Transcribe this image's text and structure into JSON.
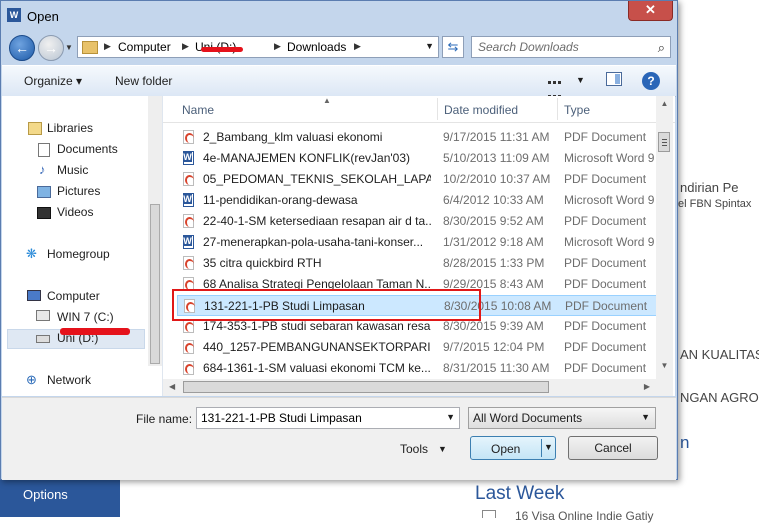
{
  "window": {
    "title": "Open",
    "close_label": "✕"
  },
  "background": {
    "options_label": "Options",
    "snippets": [
      "ndirian Pe",
      "el FBN Spintax",
      "AN KUALITAS",
      "NGAN AGRO",
      "n"
    ],
    "last_week": "Last Week",
    "partial_line": "16 Visa Online Indie Gatiy"
  },
  "address": {
    "crumbs": [
      "Computer",
      "Uni (D:)",
      "Downloads"
    ],
    "search_placeholder": "Search Downloads"
  },
  "toolbar": {
    "organize": "Organize ▾",
    "new_folder": "New folder",
    "help": "?"
  },
  "nav": {
    "libraries": "Libraries",
    "documents": "Documents",
    "music": "Music",
    "pictures": "Pictures",
    "videos": "Videos",
    "homegroup": "Homegroup",
    "computer": "Computer",
    "win7": "WIN 7 (C:)",
    "uni": "Uni (D:)",
    "network": "Network"
  },
  "list": {
    "columns": {
      "name": "Name",
      "date": "Date modified",
      "type": "Type"
    },
    "rows": [
      {
        "name": "2_Bambang_klm valuasi ekonomi",
        "date": "9/17/2015 11:31 AM",
        "type": "PDF Document",
        "icon": "pdf"
      },
      {
        "name": "4e-MANAJEMEN KONFLIK(revJan'03)",
        "date": "5/10/2013 11:09 AM",
        "type": "Microsoft Word 9",
        "icon": "word"
      },
      {
        "name": "05_PEDOMAN_TEKNIS_SEKOLAH_LAPAN...",
        "date": "10/2/2010 10:37 AM",
        "type": "PDF Document",
        "icon": "pdf"
      },
      {
        "name": "11-pendidikan-orang-dewasa",
        "date": "6/4/2012 10:33 AM",
        "type": "Microsoft Word 9",
        "icon": "word"
      },
      {
        "name": "22-40-1-SM ketersediaan resapan air d ta...",
        "date": "8/30/2015 9:52 AM",
        "type": "PDF Document",
        "icon": "pdf"
      },
      {
        "name": "27-menerapkan-pola-usaha-tani-konser...",
        "date": "1/31/2012 9:18 AM",
        "type": "Microsoft Word 9",
        "icon": "word"
      },
      {
        "name": "35 citra quickbird RTH",
        "date": "8/28/2015 1:33 PM",
        "type": "PDF Document",
        "icon": "pdf"
      },
      {
        "name": "68 Analisa Strategi Pengelolaan Taman N...",
        "date": "9/29/2015 8:43 AM",
        "type": "PDF Document",
        "icon": "pdf"
      },
      {
        "name": "131-221-1-PB Studi Limpasan",
        "date": "8/30/2015 10:08 AM",
        "type": "PDF Document",
        "icon": "pdf",
        "selected": true
      },
      {
        "name": "174-353-1-PB studi sebaran kawasan resa...",
        "date": "8/30/2015 9:39 AM",
        "type": "PDF Document",
        "icon": "pdf"
      },
      {
        "name": "440_1257-PEMBANGUNANSEKTORPARI...",
        "date": "9/7/2015 12:04 PM",
        "type": "PDF Document",
        "icon": "pdf"
      },
      {
        "name": "684-1361-1-SM valuasi ekonomi TCM ke...",
        "date": "8/31/2015 11:30 AM",
        "type": "PDF Document",
        "icon": "pdf"
      }
    ]
  },
  "bottom": {
    "file_name_label": "File name:",
    "file_name_value": "131-221-1-PB Studi Limpasan",
    "filter_value": "All Word Documents",
    "tools_label": "Tools",
    "open_label": "Open",
    "cancel_label": "Cancel"
  },
  "colors": {
    "accent": "#2b579a",
    "selection": "#cce8ff",
    "highlight": "#e01818"
  }
}
